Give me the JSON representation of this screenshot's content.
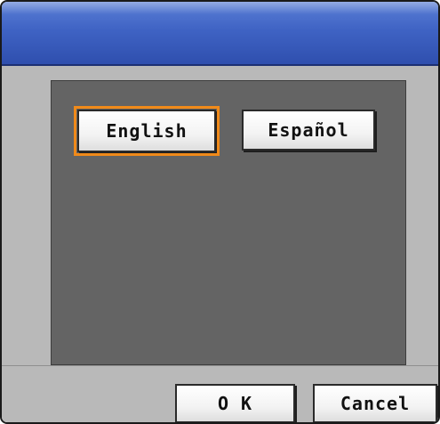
{
  "languages": {
    "english_label": "English",
    "spanish_label": "Español",
    "selected": "English"
  },
  "footer": {
    "ok_label": "O K",
    "cancel_label": "Cancel"
  },
  "colors": {
    "titlebar": "#3f63c4",
    "panel": "#b9b9b9",
    "inner_panel": "#646464",
    "selection_outline": "#f08a1a"
  }
}
